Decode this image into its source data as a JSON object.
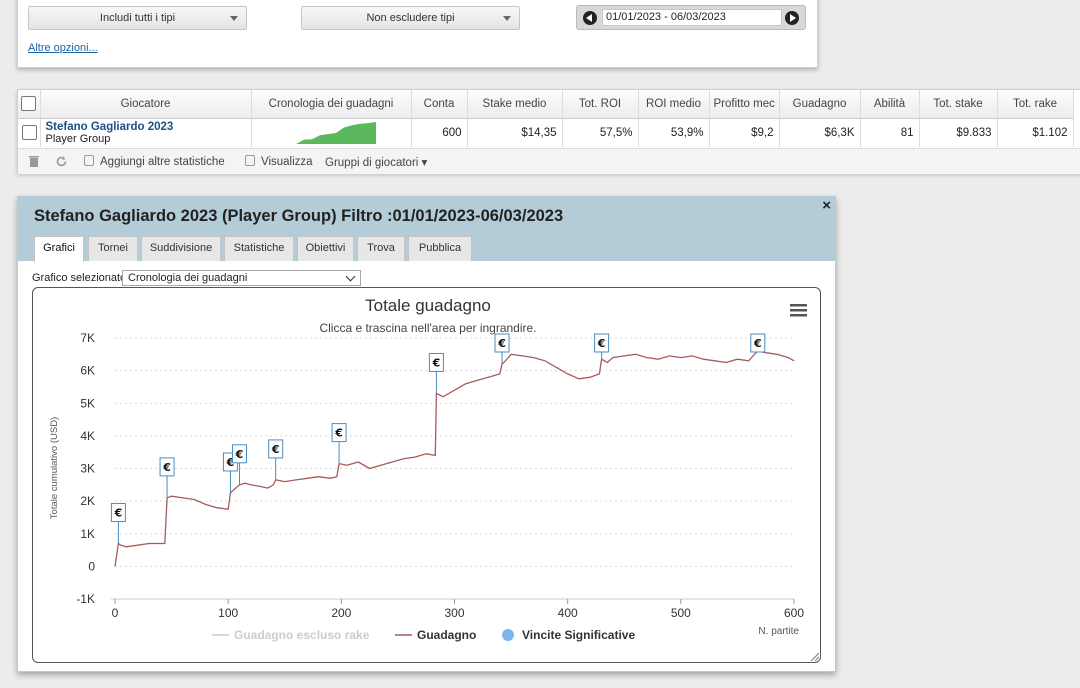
{
  "filters": {
    "types_include": "Includi tutti i tipi",
    "types_exclude": "Non escludere tipi",
    "date_range": "01/01/2023 - 06/03/2023",
    "more_options": "Altre opzioni..."
  },
  "stats_table": {
    "headers": [
      "Giocatore",
      "Cronologia dei guadagni",
      "Conta",
      "Stake medio",
      "Tot. ROI",
      "ROI medio",
      "Profitto mec",
      "Guadagno",
      "Abilità",
      "Tot. stake",
      "Tot. rake"
    ],
    "row": {
      "player_name": "Stefano Gagliardo 2023",
      "player_sub": "Player Group",
      "conta": "600",
      "stake_medio": "$14,35",
      "tot_roi": "57,5%",
      "roi_medio": "53,9%",
      "profitto_medio": "$9,2",
      "guadagno": "$6,3K",
      "abilita": "81",
      "tot_stake": "$9.833",
      "tot_rake": "$1.102"
    },
    "toolbar": {
      "add_stats": "Aggiungi altre statistiche",
      "visualize": "Visualizza",
      "groups": "Gruppi di giocatori"
    }
  },
  "dialog": {
    "title": "Stefano Gagliardo 2023 (Player Group) Filtro :01/01/2023-06/03/2023",
    "close": "×",
    "tabs": [
      "Grafici",
      "Tornei",
      "Suddivisione",
      "Statistiche",
      "Obiettivi",
      "Trova",
      "Pubblica"
    ],
    "active_tab": "Grafici",
    "chart_select_label": "Grafico selezionato",
    "chart_select_value": "Cronologia dei guadagni"
  },
  "colors": {
    "line": "#a85a5a",
    "marker_border": "#4a8cc0",
    "legend_dot": "#7cb5ec",
    "mini_chart_fill": "#5cb85c",
    "header_bg": "#b3ccd7"
  },
  "chart_data": {
    "type": "line",
    "title": "Totale guadagno",
    "subtitle": "Clicca e trascina nell'area per ingrandire.",
    "ylabel": "Totale cumulativo (USD)",
    "xlabel": "N. partite",
    "xlim": [
      0,
      600
    ],
    "ylim": [
      -1000,
      7000
    ],
    "x_ticks": [
      0,
      100,
      200,
      300,
      400,
      500,
      600
    ],
    "y_ticks": [
      -1000,
      0,
      1000,
      2000,
      3000,
      4000,
      5000,
      6000,
      7000
    ],
    "y_tick_labels": [
      "-1K",
      "0",
      "1K",
      "2K",
      "3K",
      "4K",
      "5K",
      "6K",
      "7K"
    ],
    "grid": true,
    "legend": [
      "Guadagno escluso rake",
      "Guadagno",
      "Vincite Significative"
    ],
    "legend_position": "bottom",
    "series": [
      {
        "name": "Guadagno",
        "x": [
          0,
          3,
          5,
          10,
          20,
          30,
          40,
          44,
          46,
          50,
          60,
          70,
          80,
          90,
          100,
          102,
          105,
          110,
          115,
          120,
          128,
          135,
          140,
          142,
          150,
          160,
          170,
          180,
          190,
          196,
          198,
          205,
          215,
          225,
          235,
          245,
          255,
          265,
          275,
          283,
          284,
          290,
          300,
          310,
          320,
          330,
          340,
          342,
          345,
          350,
          360,
          370,
          380,
          390,
          400,
          410,
          420,
          428,
          430,
          435,
          440,
          450,
          460,
          470,
          480,
          490,
          500,
          510,
          520,
          530,
          540,
          550,
          560,
          565,
          568,
          575,
          585,
          595,
          600
        ],
        "y": [
          0,
          700,
          650,
          600,
          650,
          700,
          700,
          700,
          2100,
          2150,
          2100,
          2050,
          1900,
          1800,
          1750,
          2250,
          2350,
          2500,
          2550,
          2500,
          2450,
          2400,
          2500,
          2650,
          2600,
          2650,
          2700,
          2750,
          2700,
          2750,
          3150,
          3100,
          3200,
          3000,
          3100,
          3200,
          3300,
          3350,
          3450,
          3400,
          5300,
          5200,
          5400,
          5600,
          5700,
          5800,
          5900,
          6200,
          6300,
          6500,
          6450,
          6400,
          6300,
          6100,
          5900,
          5750,
          5800,
          5900,
          6350,
          6250,
          6400,
          6450,
          6500,
          6400,
          6350,
          6450,
          6400,
          6450,
          6350,
          6300,
          6250,
          6350,
          6300,
          6500,
          6600,
          6550,
          6500,
          6400,
          6300
        ]
      }
    ],
    "significant_wins": [
      {
        "x": 3,
        "y": 700,
        "label": "€"
      },
      {
        "x": 46,
        "y": 2100,
        "label": "€"
      },
      {
        "x": 102,
        "y": 2250,
        "label": "€"
      },
      {
        "x": 110,
        "y": 2500,
        "label": "€"
      },
      {
        "x": 142,
        "y": 2650,
        "label": "€"
      },
      {
        "x": 198,
        "y": 3150,
        "label": "€"
      },
      {
        "x": 284,
        "y": 5300,
        "label": "€"
      },
      {
        "x": 342,
        "y": 6200,
        "label": "€"
      },
      {
        "x": 430,
        "y": 6350,
        "label": "€"
      },
      {
        "x": 568,
        "y": 6600,
        "label": "€"
      }
    ],
    "mini_sparkline": [
      0,
      20,
      22,
      40,
      45,
      50,
      75,
      85,
      92,
      95,
      100
    ]
  }
}
